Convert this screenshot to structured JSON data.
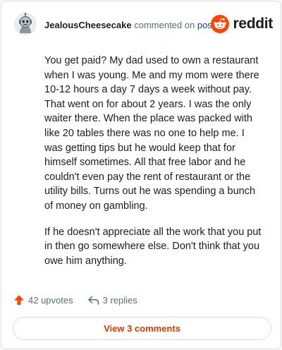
{
  "comment": {
    "username": "JealousCheesecake",
    "commented_text": "commented on",
    "post_link": "post",
    "paragraphs": [
      "You get paid? My dad used to own a restaurant when I was young. Me and my mom were there 10-12 hours a day 7 days a week without pay. That went on for about 2 years. I was the only waiter there. When the place was packed with like 20 tables there was no one to help me. I was getting tips but he would keep that for himself sometimes. All that free labor and he couldn't even pay the rent of restaurant or the utility bills. Turns out he was spending a bunch of money on gambling.",
      "If he doesn't appreciate all the work that you put in then go somewhere else. Don't think that you owe him anything."
    ],
    "upvotes": "42 upvotes",
    "replies": "3 replies",
    "view_button": "View 3 comments"
  },
  "brand": {
    "wordmark": "reddit",
    "color": "#ff4500"
  },
  "icons": [
    "avatar",
    "reddit-logo-icon",
    "upvote-arrow-icon",
    "reply-arrow-icon"
  ],
  "colors": {
    "accent": "#d93a00",
    "upvote": "#ff4500",
    "link": "#0a449b",
    "muted": "#576f76"
  }
}
